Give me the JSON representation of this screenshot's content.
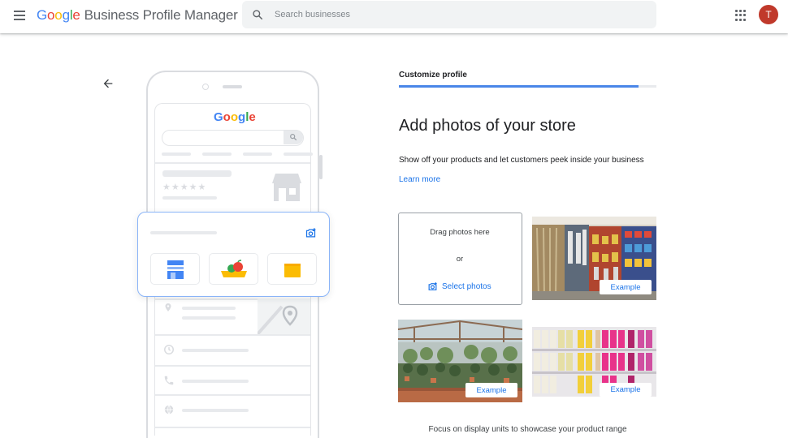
{
  "header": {
    "menu_icon": "hamburger-menu-icon",
    "brand_google": "Google",
    "brand_rest": "Business Profile Manager",
    "search_placeholder": "Search businesses",
    "apps_icon": "apps-grid-icon",
    "avatar_initial": "T",
    "avatar_color": "#c0392b"
  },
  "illustration": {
    "google_logo": "Google"
  },
  "main": {
    "back_icon": "arrow-back-icon",
    "step_label": "Customize profile",
    "progress": 0.93,
    "title": "Add photos of your store",
    "description": "Show off your products and let customers peek inside your business",
    "learn_more": "Learn more",
    "dropzone": {
      "drag_text": "Drag photos here",
      "or_text": "or",
      "select_label": "Select photos"
    },
    "examples": [
      "Example",
      "Example",
      "Example"
    ],
    "caption": "Focus on display units to showcase your product range"
  },
  "colors": {
    "accent": "#1a73e8",
    "progress": "#4a86e8",
    "border": "#dadce0"
  }
}
